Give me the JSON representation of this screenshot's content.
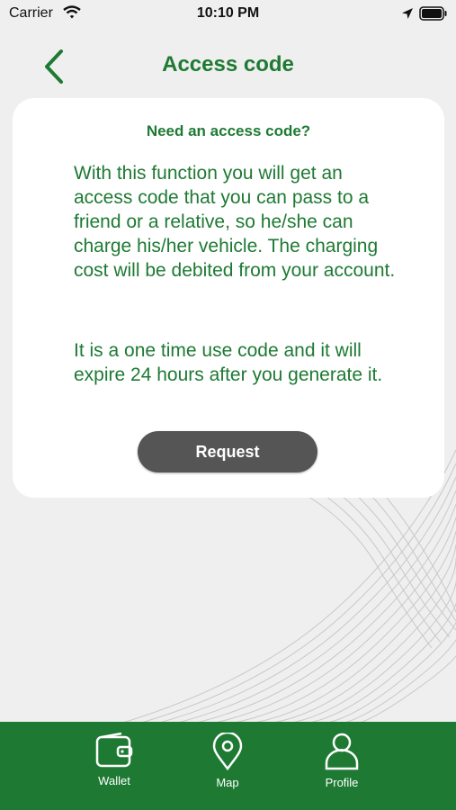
{
  "status_bar": {
    "carrier": "Carrier",
    "time": "10:10 PM"
  },
  "header": {
    "title": "Access code"
  },
  "card": {
    "heading": "Need an access code?",
    "paragraph1": "With this function you will get an access code that you can pass to a friend or a relative, so he/she can charge his/her vehicle. The charging cost will be debited from your account.",
    "paragraph2": "It is a one time use code and it will expire 24 hours after you generate it.",
    "button_label": "Request"
  },
  "tab_bar": {
    "items": [
      {
        "label": "Wallet",
        "icon": "wallet-icon"
      },
      {
        "label": "Map",
        "icon": "map-pin-icon"
      },
      {
        "label": "Profile",
        "icon": "profile-icon"
      }
    ]
  },
  "colors": {
    "accent": "#1e7a33",
    "background": "#efefef",
    "button": "#555555"
  }
}
